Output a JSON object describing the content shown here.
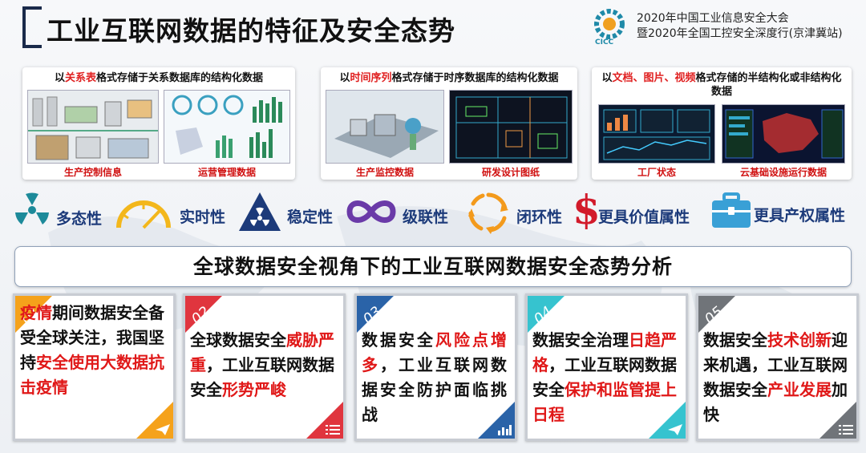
{
  "title": "工业互联网数据的特征及安全态势",
  "conference": {
    "line1": "2020年中国工业信息安全大会",
    "line2": "暨2020年全国工控安全深度行(京津冀站)",
    "logo_text": "CICC"
  },
  "panels": [
    {
      "prefix": "以",
      "highlight": "关系表",
      "suffix": "格式存储于关系数据库的结构化数据",
      "captions": [
        "生产控制信息",
        "运营管理数据"
      ]
    },
    {
      "prefix": "以",
      "highlight": "时间序列",
      "suffix": "格式存储于时序数据库的结构化数据",
      "captions": [
        "生产监控数据",
        "研发设计图纸"
      ]
    },
    {
      "prefix": "以",
      "highlight": "文档、图片、视频",
      "suffix": "格式存储的半结构化或非结构化数据",
      "captions": [
        "工厂状态",
        "云基础设施运行数据"
      ]
    }
  ],
  "attributes": [
    {
      "label": "多态性",
      "icon": "radiation-icon"
    },
    {
      "label": "实时性",
      "icon": "speedometer-icon"
    },
    {
      "label": "稳定性",
      "icon": "hazard-triangle-icon"
    },
    {
      "label": "级联性",
      "icon": "infinity-icon"
    },
    {
      "label": "闭环性",
      "icon": "cycle-arrows-icon"
    },
    {
      "label": "更具价值属性",
      "icon": "dollar-icon"
    },
    {
      "label": "更具产权属性",
      "icon": "briefcase-icon"
    }
  ],
  "banner": "全球数据安全视角下的工业互联网数据安全态势分析",
  "cards": [
    {
      "num": "01",
      "color": "#f5a21b",
      "segments": [
        {
          "t": "疫情",
          "r": true
        },
        {
          "t": "期间数据安全备受全球关注，我国坚持",
          "r": false
        },
        {
          "t": "安全使用大数据抗击疫情",
          "r": true
        }
      ]
    },
    {
      "num": "02",
      "color": "#e0353e",
      "segments": [
        {
          "t": "全球数据安全",
          "r": false
        },
        {
          "t": "威胁严重",
          "r": true
        },
        {
          "t": "，工业互联网数据安全",
          "r": false
        },
        {
          "t": "形势严峻",
          "r": true
        }
      ]
    },
    {
      "num": "03",
      "color": "#2a63a8",
      "segments": [
        {
          "t": "数据安全",
          "r": false
        },
        {
          "t": "风险点增多",
          "r": true
        },
        {
          "t": "，工业互联网数据安全防护面临挑战",
          "r": false
        }
      ]
    },
    {
      "num": "04",
      "color": "#36c3cf",
      "segments": [
        {
          "t": "数据安全治理",
          "r": false
        },
        {
          "t": "日趋严格",
          "r": true
        },
        {
          "t": "，工业互联网数据安全",
          "r": false
        },
        {
          "t": "保护和监管提上日程",
          "r": true
        }
      ]
    },
    {
      "num": "05",
      "color": "#707479",
      "segments": [
        {
          "t": "数据安全",
          "r": false
        },
        {
          "t": "技术创新",
          "r": true
        },
        {
          "t": "迎来机遇，工业互联网数据安全",
          "r": false
        },
        {
          "t": "产业发展",
          "r": true
        },
        {
          "t": "加快",
          "r": false
        }
      ]
    }
  ],
  "colors": {
    "highlight": "#e01818",
    "title": "#111111",
    "attr_label": "#1c3a7a",
    "icon_teal": "#1d8a9a",
    "icon_navy": "#1c3a7a"
  }
}
